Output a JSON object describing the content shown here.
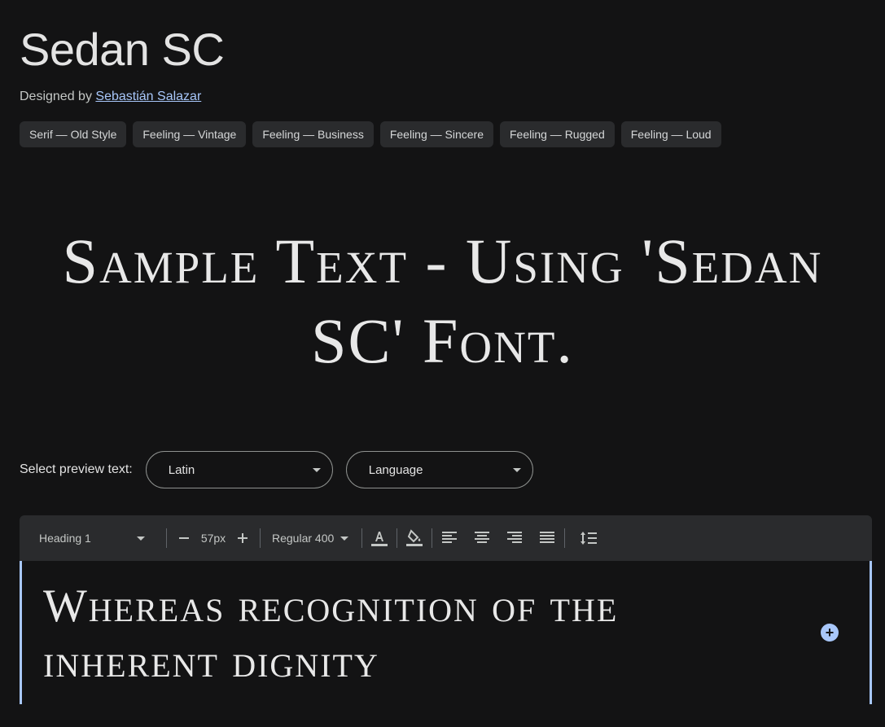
{
  "font": {
    "name": "Sedan SC",
    "designed_by_label": "Designed by",
    "designer": "Sebastián Salazar"
  },
  "tags": [
    "Serif — Old Style",
    "Feeling — Vintage",
    "Feeling — Business",
    "Feeling — Sincere",
    "Feeling — Rugged",
    "Feeling — Loud"
  ],
  "hero": {
    "text": "Sample Text - Using 'Sedan SC' Font."
  },
  "preview": {
    "label": "Select preview text:",
    "script_select": "Latin",
    "language_select": "Language"
  },
  "toolbar": {
    "style": "Heading 1",
    "size": "57px",
    "weight": "Regular 400",
    "decrease_icon": "minus-icon",
    "increase_icon": "plus-icon"
  },
  "editor": {
    "text": "Whereas recognition of the inherent dignity"
  },
  "colors": {
    "background": "#131314",
    "accent": "#a8c7fa",
    "chip": "#2a2b2d",
    "toolbar": "#2a2b2d"
  }
}
